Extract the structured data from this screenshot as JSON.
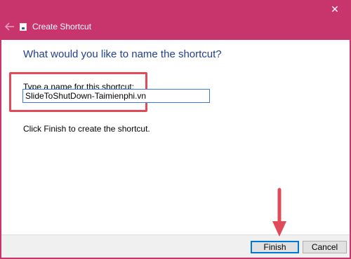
{
  "window": {
    "title": "Create Shortcut",
    "close_label": "✕"
  },
  "main": {
    "heading": "What would you like to name the shortcut?",
    "field_label": "Type a name for this shortcut:",
    "name_value": "SlideToShutDown-Taimienphi.vn",
    "instruction": "Click Finish to create the shortcut."
  },
  "footer": {
    "finish_label": "Finish",
    "cancel_label": "Cancel"
  },
  "colors": {
    "titlebar": "#c8346c",
    "heading": "#1f3f8f",
    "annotation": "#e04a59",
    "focus": "#0078d7"
  },
  "icons": {
    "back": "back-arrow-icon",
    "app": "shortcut-icon",
    "close": "close-icon",
    "annotation_arrow": "down-arrow-icon"
  }
}
